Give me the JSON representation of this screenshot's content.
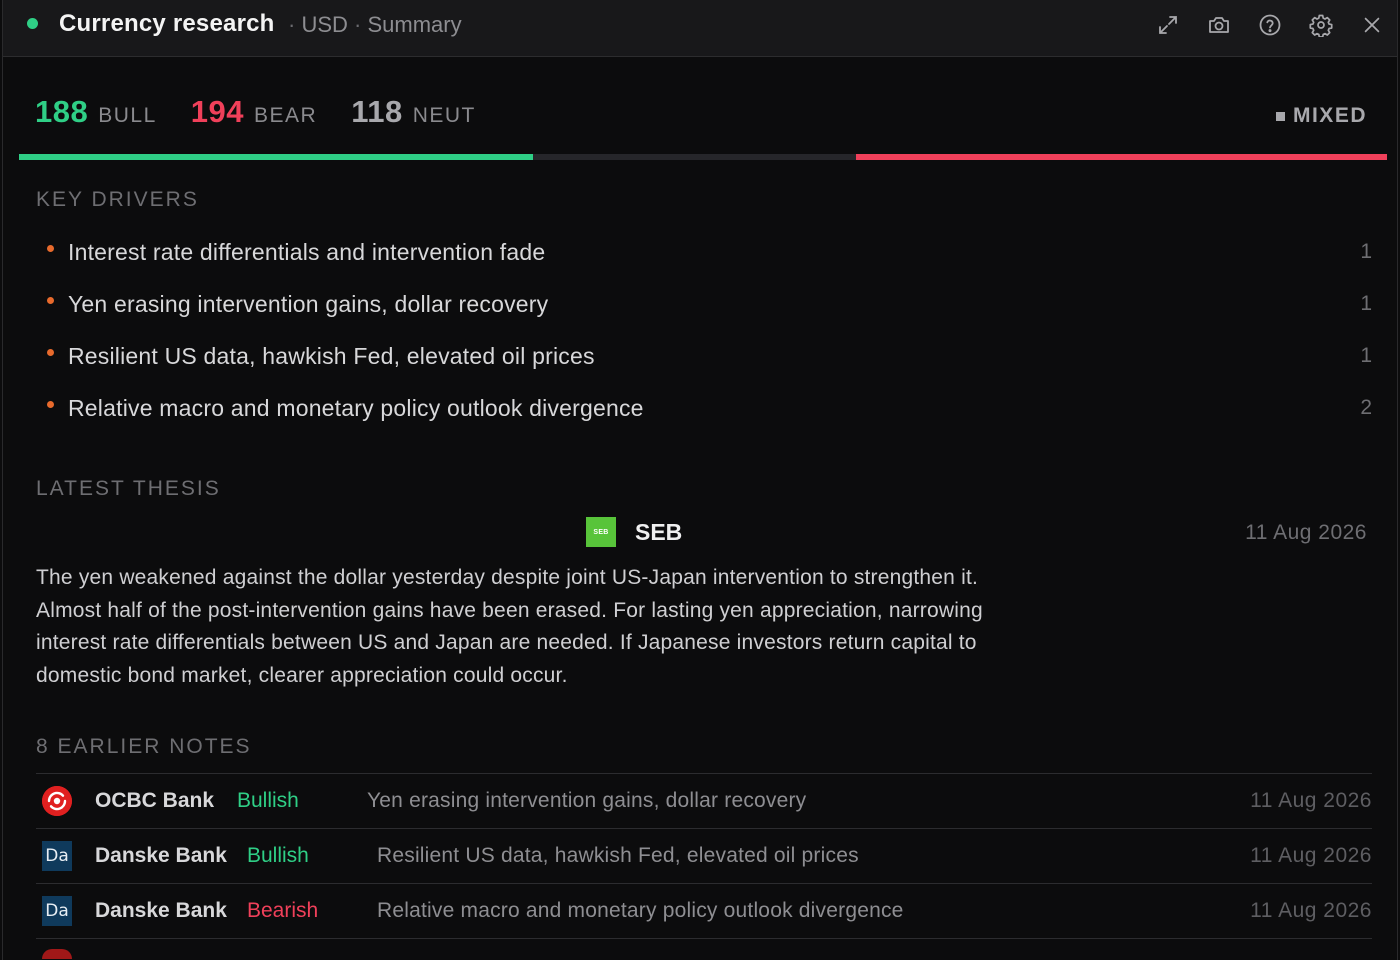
{
  "header": {
    "title": "Currency research",
    "crumb_sep1": "·",
    "currency": "USD",
    "crumb_sep2": "·",
    "view": "Summary",
    "icons": [
      "expand-icon",
      "camera-icon",
      "help-icon",
      "gear-icon",
      "close-icon"
    ]
  },
  "sentiment": {
    "bull": {
      "count": "188",
      "label": "BULL"
    },
    "bear": {
      "count": "194",
      "label": "BEAR"
    },
    "neut": {
      "count": "118",
      "label": "NEUT"
    },
    "overall": "MIXED"
  },
  "colors": {
    "bull": "#2fcf86",
    "bear": "#f0405a",
    "neutral": "#a8a8ac",
    "accent_bullet": "#e86a2c",
    "background": "#0c0c0d"
  },
  "key_drivers": {
    "title": "KEY DRIVERS",
    "items": [
      {
        "text": "Interest rate differentials and intervention fade",
        "count": "1"
      },
      {
        "text": "Yen erasing intervention gains, dollar recovery",
        "count": "1"
      },
      {
        "text": "Resilient US data, hawkish Fed, elevated oil prices",
        "count": "1"
      },
      {
        "text": "Relative macro and monetary policy outlook divergence",
        "count": "2"
      }
    ]
  },
  "latest_thesis": {
    "title": "LATEST THESIS",
    "source": "SEB",
    "source_logo_text": "SEB",
    "date": "11 Aug 2026",
    "body": "The yen weakened against the dollar yesterday despite joint US-Japan intervention to strengthen it. Almost half of the post-intervention gains have been erased. For lasting yen appreciation, narrowing interest rate differentials between US and Japan are needed. If Japanese investors return capital to domestic bond market, clearer appreciation could occur."
  },
  "earlier_notes": {
    "title": "8 EARLIER NOTES",
    "items": [
      {
        "bank": "OCBC Bank",
        "logo": "ocbc-logo-icon",
        "sentiment": "Bullish",
        "summary": "Yen erasing intervention gains, dollar recovery",
        "date": "11 Aug 2026"
      },
      {
        "bank": "Danske Bank",
        "logo": "danske-logo-icon",
        "logo_text": "Da",
        "sentiment": "Bullish",
        "summary": "Resilient US data, hawkish Fed, elevated oil prices",
        "date": "11 Aug 2026"
      },
      {
        "bank": "Danske Bank",
        "logo": "danske-logo-icon",
        "logo_text": "Da",
        "sentiment": "Bearish",
        "summary": "Relative macro and monetary policy outlook divergence",
        "date": "11 Aug 2026"
      }
    ]
  }
}
